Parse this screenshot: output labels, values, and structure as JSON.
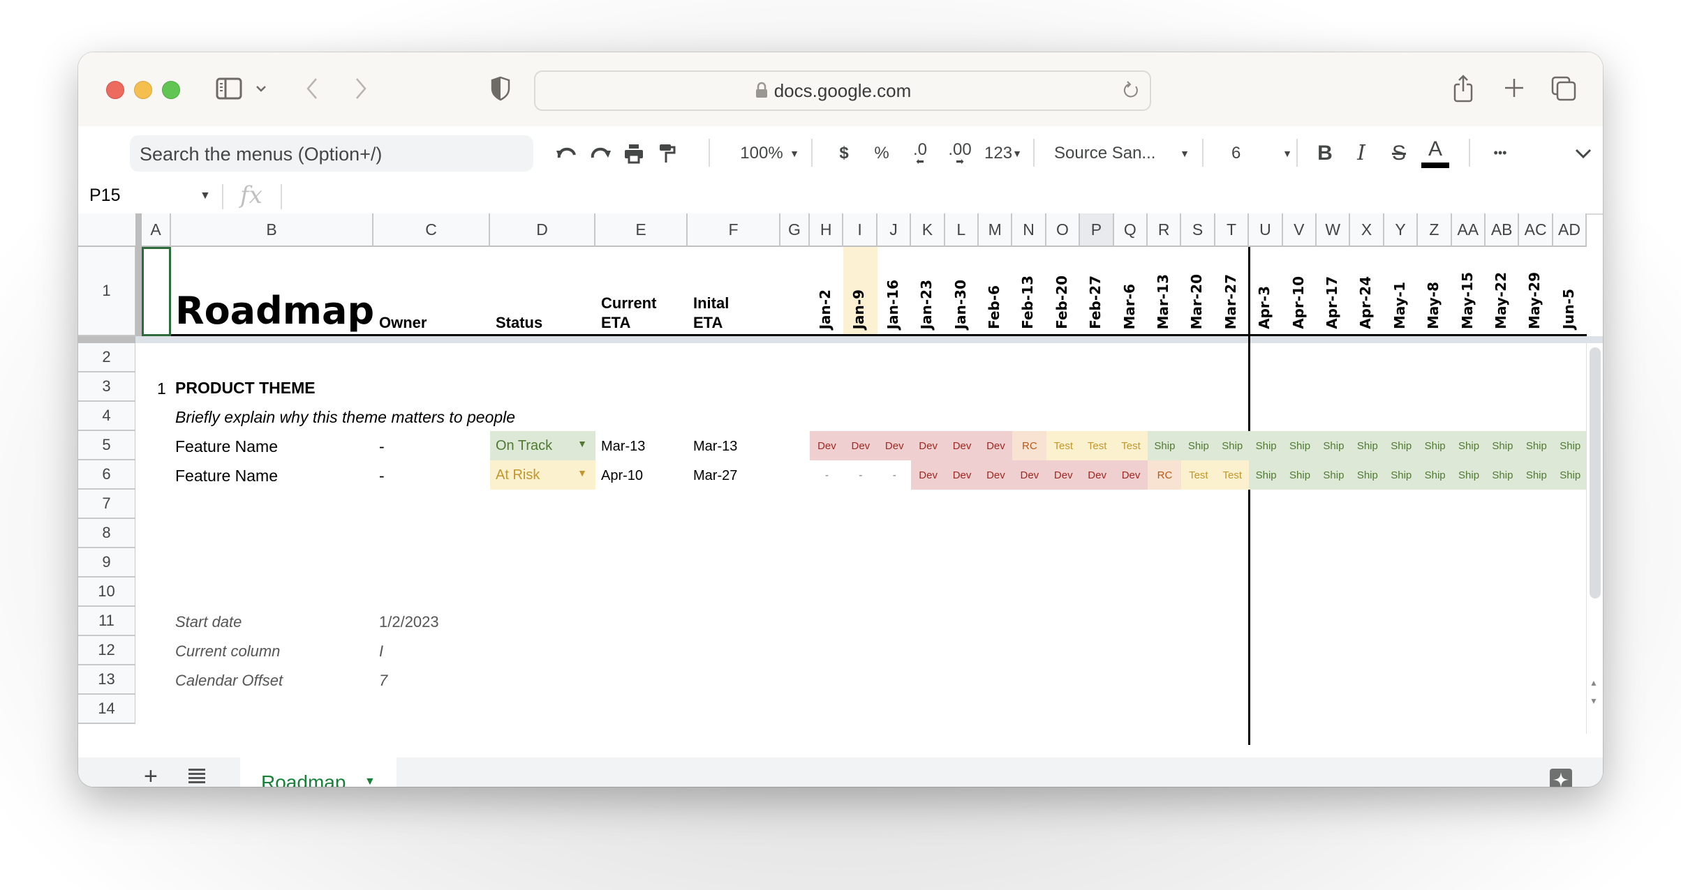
{
  "browser": {
    "url_host": "docs.google.com",
    "icons": [
      "sidebar-toggle-icon",
      "chevron-down-icon",
      "back-icon",
      "forward-icon",
      "privacy-shield-icon",
      "lock-icon",
      "reload-icon",
      "share-icon",
      "new-tab-icon",
      "tab-overview-icon"
    ]
  },
  "toolbar": {
    "search_placeholder": "Search the menus (Option+/)",
    "zoom": "100%",
    "currency": "$",
    "percent": "%",
    "decrease_decimal": ".0",
    "increase_decimal": ".00",
    "number_format": "123",
    "font": "Source San...",
    "font_size": "6",
    "bold": "B",
    "italic": "I",
    "strike": "S",
    "text_color": "A",
    "more": "•••"
  },
  "formula_bar": {
    "name_box": "P15",
    "fx": "fx",
    "value": ""
  },
  "columns": [
    "A",
    "B",
    "C",
    "D",
    "E",
    "F",
    "G",
    "H",
    "I",
    "J",
    "K",
    "L",
    "M",
    "N",
    "O",
    "P",
    "Q",
    "R",
    "S",
    "T",
    "U",
    "V",
    "W",
    "X",
    "Y",
    "Z",
    "AA",
    "AB",
    "AC",
    "AD"
  ],
  "selected_column": "P",
  "rows": [
    "1",
    "2",
    "3",
    "4",
    "5",
    "6",
    "7",
    "8",
    "9",
    "10",
    "11",
    "12",
    "13",
    "14"
  ],
  "header_row": {
    "title": "Roadmap",
    "owner": "Owner",
    "status": "Status",
    "current_eta_1": "Current",
    "current_eta_2": "ETA",
    "initial_eta_1": "Inital",
    "initial_eta_2": "ETA",
    "dates": [
      "Jan-2",
      "Jan-9",
      "Jan-16",
      "Jan-23",
      "Jan-30",
      "Feb-6",
      "Feb-13",
      "Feb-20",
      "Feb-27",
      "Mar-6",
      "Mar-13",
      "Mar-20",
      "Mar-27",
      "Apr-3",
      "Apr-10",
      "Apr-17",
      "Apr-24",
      "May-1",
      "May-8",
      "May-15",
      "May-22",
      "May-29",
      "Jun-5"
    ],
    "highlighted_date": "Jan-9"
  },
  "theme": {
    "number": "1",
    "title": "PRODUCT THEME",
    "description": "Briefly explain why this theme matters to people"
  },
  "features": [
    {
      "name": "Feature Name",
      "owner": "-",
      "status": "On Track",
      "status_color": "#dde9d6",
      "status_text_color": "#4f7a32",
      "current_eta": "Mar-13",
      "initial_eta": "Mar-13",
      "timeline": [
        "Dev",
        "Dev",
        "Dev",
        "Dev",
        "Dev",
        "Dev",
        "RC",
        "Test",
        "Test",
        "Test",
        "Ship",
        "Ship",
        "Ship",
        "Ship",
        "Ship",
        "Ship",
        "Ship",
        "Ship",
        "Ship",
        "Ship",
        "Ship",
        "Ship",
        "Ship"
      ]
    },
    {
      "name": "Feature Name",
      "owner": "-",
      "status": "At Risk",
      "status_color": "#fbf1cf",
      "status_text_color": "#c2972b",
      "current_eta": "Apr-10",
      "initial_eta": "Mar-27",
      "timeline": [
        "-",
        "-",
        "-",
        "Dev",
        "Dev",
        "Dev",
        "Dev",
        "Dev",
        "Dev",
        "Dev",
        "RC",
        "Test",
        "Test",
        "Ship",
        "Ship",
        "Ship",
        "Ship",
        "Ship",
        "Ship",
        "Ship",
        "Ship",
        "Ship",
        "Ship"
      ]
    }
  ],
  "settings": [
    {
      "label": "Start date",
      "value": "1/2/2023"
    },
    {
      "label": "Current column",
      "value": "I"
    },
    {
      "label": "Calendar Offset",
      "value": "7"
    }
  ],
  "sheet_tabs": [
    {
      "label": "Roadmap",
      "active": true
    }
  ],
  "colors": {
    "dev_bg": "#f0cfd1",
    "dev_text": "#9c2a22",
    "rc_bg": "#f8e3d3",
    "rc_text": "#b45b1c",
    "test_bg": "#fbf1cf",
    "test_text": "#c2972b",
    "ship_bg": "#dde9d6",
    "ship_text": "#4f7a32",
    "sheet_tab_accent": "#188038"
  }
}
